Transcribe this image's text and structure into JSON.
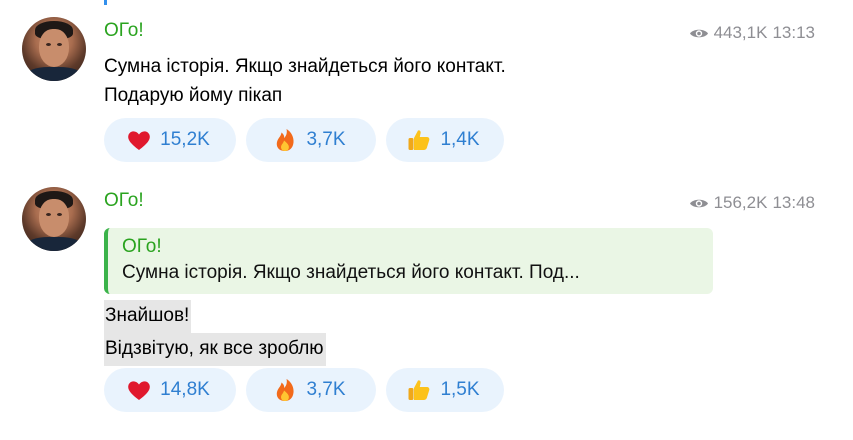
{
  "messages": [
    {
      "sender": "ОГо!",
      "views": "443,1K",
      "time": "13:13",
      "text": "Сумна історія. Якщо знайдеться його контакт.\nПодарую йому пікап",
      "reactions": [
        {
          "icon": "heart-icon",
          "count": "15,2K"
        },
        {
          "icon": "fire-icon",
          "count": "3,7K"
        },
        {
          "icon": "thumbs-up-icon",
          "count": "1,4K"
        }
      ]
    },
    {
      "sender": "ОГо!",
      "views": "156,2K",
      "time": "13:48",
      "reply": {
        "sender": "ОГо!",
        "text": "Сумна історія. Якщо знайдеться його контакт. Под..."
      },
      "lines": [
        "Знайшов!",
        "Відзвітую, як все зроблю"
      ],
      "reactions": [
        {
          "icon": "heart-icon",
          "count": "14,8K"
        },
        {
          "icon": "fire-icon",
          "count": "3,7K"
        },
        {
          "icon": "thumbs-up-icon",
          "count": "1,5K"
        }
      ]
    }
  ],
  "colors": {
    "sender": "#2aa31f",
    "reaction_bg": "#e9f3fd",
    "reaction_text": "#2f7fd1",
    "reply_bg": "#eaf6e5",
    "reply_bar": "#3bb34a",
    "meta": "#8e8e93"
  }
}
